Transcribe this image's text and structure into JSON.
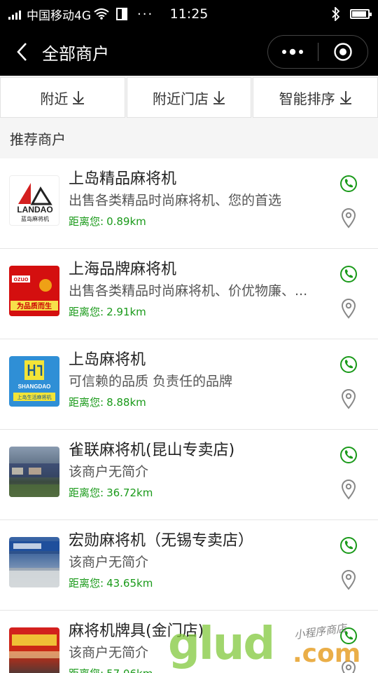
{
  "status_bar": {
    "carrier": "中国移动4G",
    "dots": "···",
    "time": "11:25"
  },
  "nav": {
    "title": "全部商户"
  },
  "filters": [
    {
      "label": "附近"
    },
    {
      "label": "附近门店"
    },
    {
      "label": "智能排序"
    }
  ],
  "section": {
    "title": "推荐商户"
  },
  "distance_label": "距离您:",
  "merchants": [
    {
      "name": "上岛精品麻将机",
      "desc": "出售各类精品时尚麻将机、您的首选",
      "distance": "0.89km",
      "logo_text": "LANDAO",
      "logo_sub": "蓝岛麻将机"
    },
    {
      "name": "上海品牌麻将机",
      "desc": "出售各类精品时尚麻将机、价优物廉、...",
      "distance": "2.91km",
      "logo_text": "ozuo",
      "logo_sub": "为品质而生"
    },
    {
      "name": "上岛麻将机",
      "desc": "可信赖的品质 负责任的品牌",
      "distance": "8.88km",
      "logo_text": "SHANGDAO",
      "logo_sub": "上岛生活麻将机"
    },
    {
      "name": "雀联麻将机(昆山专卖店)",
      "desc": "该商户无简介",
      "distance": "36.72km"
    },
    {
      "name": "宏勋麻将机（无锡专卖店）",
      "desc": "该商户无简介",
      "distance": "43.65km"
    },
    {
      "name": "麻将机牌具(金门店)",
      "desc": "该商户无简介",
      "distance": "57.06km"
    }
  ],
  "watermark": {
    "big": "glud",
    "com": ".com",
    "small": "小程序商店"
  },
  "colors": {
    "accent_green": "#1a9a1a",
    "nav_bg": "#000000"
  }
}
